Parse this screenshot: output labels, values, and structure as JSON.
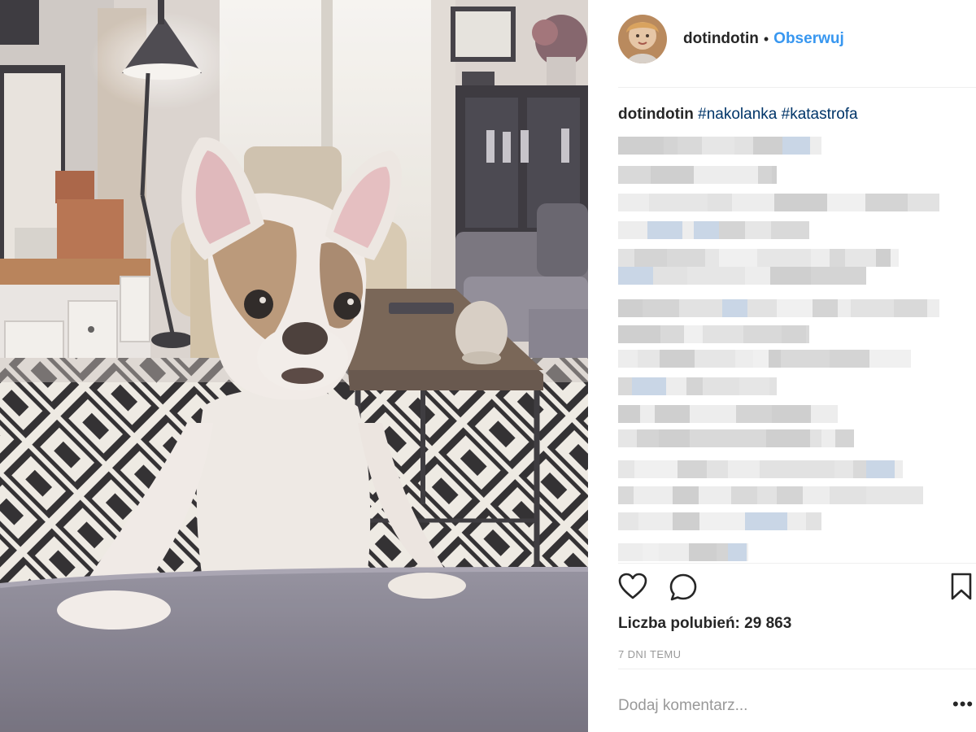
{
  "post": {
    "username": "dotindotin",
    "follow_label": "Obserwuj",
    "separator": "•",
    "caption_user": "dotindotin",
    "caption_tags": [
      "#nakolanka",
      "#katastrofa"
    ],
    "likes_label": "Liczba polubień: 29 863",
    "time_label": "7 DNI TEMU",
    "comment_placeholder": "Dodaj komentarz...",
    "more_label": "•••"
  },
  "icons": {
    "like": "heart-outline-icon",
    "comment": "speech-bubble-icon",
    "save": "bookmark-icon",
    "options": "ellipsis-icon"
  },
  "colors": {
    "link_blue": "#3897f0",
    "hashtag": "#003569",
    "muted": "#999999",
    "text": "#262626"
  }
}
